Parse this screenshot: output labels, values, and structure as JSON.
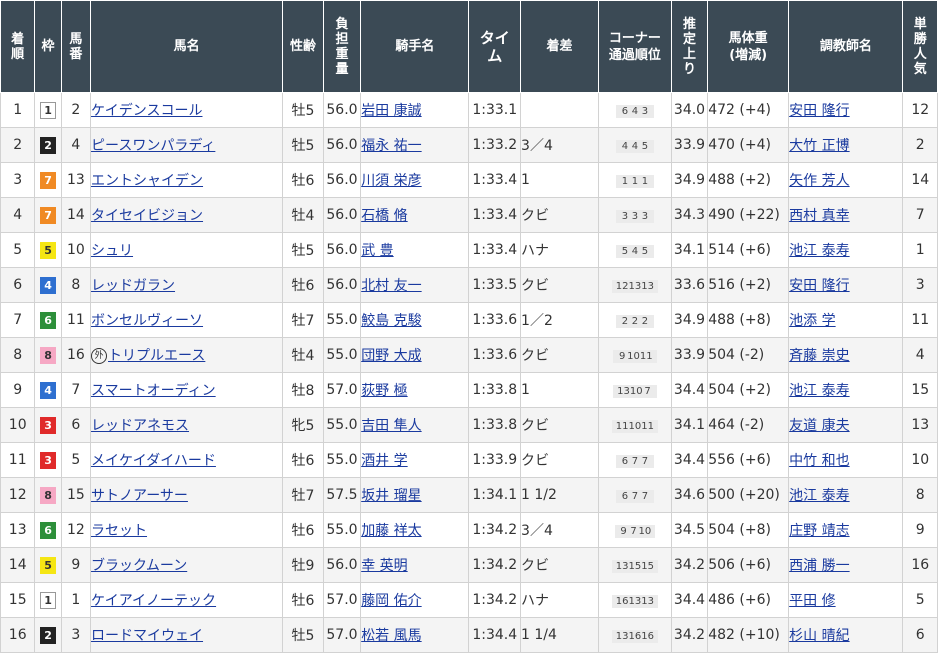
{
  "headers": {
    "rank": "着順",
    "waku": "枠",
    "umaban": "馬番",
    "horse": "馬名",
    "sexage": "性齢",
    "weight": "負担重量",
    "jockey": "騎手名",
    "time": "タイム",
    "margin": "着差",
    "corner": "コーナー通過順位",
    "last3f": "推定上り",
    "body": "馬体重(増減)",
    "trainer": "調教師名",
    "pop": "単勝人気"
  },
  "waku_colors": {
    "1": {
      "bg": "#ffffff",
      "fg": "#333333",
      "border": "#999999"
    },
    "2": {
      "bg": "#222222",
      "fg": "#ffffff",
      "border": "#222222"
    },
    "3": {
      "bg": "#e02a2a",
      "fg": "#ffffff",
      "border": "#e02a2a"
    },
    "4": {
      "bg": "#2e6fd0",
      "fg": "#ffffff",
      "border": "#2e6fd0"
    },
    "5": {
      "bg": "#f5e614",
      "fg": "#333333",
      "border": "#f5e614"
    },
    "6": {
      "bg": "#2d8f3a",
      "fg": "#ffffff",
      "border": "#2d8f3a"
    },
    "7": {
      "bg": "#f08a24",
      "fg": "#ffffff",
      "border": "#f08a24"
    },
    "8": {
      "bg": "#f6a8c4",
      "fg": "#333333",
      "border": "#f6a8c4"
    }
  },
  "rows": [
    {
      "rank": "1",
      "waku": "1",
      "umaban": "2",
      "horse": "ケイデンスコール",
      "foreign": false,
      "sexage": "牡5",
      "weight": "56.0",
      "jockey": "岩田 康誠",
      "time": "1:33.1",
      "margin": "",
      "corner": [
        "6",
        "4",
        "3"
      ],
      "last3f": "34.0",
      "body": "472 (+4)",
      "trainer": "安田 隆行",
      "pop": "12"
    },
    {
      "rank": "2",
      "waku": "2",
      "umaban": "4",
      "horse": "ピースワンパラディ",
      "foreign": false,
      "sexage": "牡5",
      "weight": "56.0",
      "jockey": "福永 祐一",
      "time": "1:33.2",
      "margin": "3／4",
      "corner": [
        "4",
        "4",
        "5"
      ],
      "last3f": "33.9",
      "body": "470 (+4)",
      "trainer": "大竹 正博",
      "pop": "2"
    },
    {
      "rank": "3",
      "waku": "7",
      "umaban": "13",
      "horse": "エントシャイデン",
      "foreign": false,
      "sexage": "牡6",
      "weight": "56.0",
      "jockey": "川須 栄彦",
      "time": "1:33.4",
      "margin": "1",
      "corner": [
        "1",
        "1",
        "1"
      ],
      "last3f": "34.9",
      "body": "488 (+2)",
      "trainer": "矢作 芳人",
      "pop": "14"
    },
    {
      "rank": "4",
      "waku": "7",
      "umaban": "14",
      "horse": "タイセイビジョン",
      "foreign": false,
      "sexage": "牡4",
      "weight": "56.0",
      "jockey": "石橋 脩",
      "time": "1:33.4",
      "margin": "クビ",
      "corner": [
        "3",
        "3",
        "3"
      ],
      "last3f": "34.3",
      "body": "490 (+22)",
      "trainer": "西村 真幸",
      "pop": "7"
    },
    {
      "rank": "5",
      "waku": "5",
      "umaban": "10",
      "horse": "シュリ",
      "foreign": false,
      "sexage": "牡5",
      "weight": "56.0",
      "jockey": "武 豊",
      "time": "1:33.4",
      "margin": "ハナ",
      "corner": [
        "5",
        "4",
        "5"
      ],
      "last3f": "34.1",
      "body": "514 (+6)",
      "trainer": "池江 泰寿",
      "pop": "1"
    },
    {
      "rank": "6",
      "waku": "4",
      "umaban": "8",
      "horse": "レッドガラン",
      "foreign": false,
      "sexage": "牡6",
      "weight": "56.0",
      "jockey": "北村 友一",
      "time": "1:33.5",
      "margin": "クビ",
      "corner": [
        "12",
        "13",
        "13"
      ],
      "last3f": "33.6",
      "body": "516 (+2)",
      "trainer": "安田 隆行",
      "pop": "3"
    },
    {
      "rank": "7",
      "waku": "6",
      "umaban": "11",
      "horse": "ボンセルヴィーソ",
      "foreign": false,
      "sexage": "牡7",
      "weight": "55.0",
      "jockey": "鮫島 克駿",
      "time": "1:33.6",
      "margin": "1／2",
      "corner": [
        "2",
        "2",
        "2"
      ],
      "last3f": "34.9",
      "body": "488 (+8)",
      "trainer": "池添 学",
      "pop": "11"
    },
    {
      "rank": "8",
      "waku": "8",
      "umaban": "16",
      "horse": "トリプルエース",
      "foreign": true,
      "foreign_mark": "外",
      "sexage": "牡4",
      "weight": "55.0",
      "jockey": "団野 大成",
      "time": "1:33.6",
      "margin": "クビ",
      "corner": [
        "9",
        "10",
        "11"
      ],
      "last3f": "33.9",
      "body": "504 (-2)",
      "trainer": "斉藤 崇史",
      "pop": "4"
    },
    {
      "rank": "9",
      "waku": "4",
      "umaban": "7",
      "horse": "スマートオーディン",
      "foreign": false,
      "sexage": "牡8",
      "weight": "57.0",
      "jockey": "荻野 極",
      "time": "1:33.8",
      "margin": "1",
      "corner": [
        "13",
        "10",
        "7"
      ],
      "last3f": "34.4",
      "body": "504 (+2)",
      "trainer": "池江 泰寿",
      "pop": "15"
    },
    {
      "rank": "10",
      "waku": "3",
      "umaban": "6",
      "horse": "レッドアネモス",
      "foreign": false,
      "sexage": "牝5",
      "weight": "55.0",
      "jockey": "吉田 隼人",
      "time": "1:33.8",
      "margin": "クビ",
      "corner": [
        "11",
        "10",
        "11"
      ],
      "last3f": "34.1",
      "body": "464 (-2)",
      "trainer": "友道 康夫",
      "pop": "13"
    },
    {
      "rank": "11",
      "waku": "3",
      "umaban": "5",
      "horse": "メイケイダイハード",
      "foreign": false,
      "sexage": "牡6",
      "weight": "55.0",
      "jockey": "酒井 学",
      "time": "1:33.9",
      "margin": "クビ",
      "corner": [
        "6",
        "7",
        "7"
      ],
      "last3f": "34.4",
      "body": "556 (+6)",
      "trainer": "中竹 和也",
      "pop": "10"
    },
    {
      "rank": "12",
      "waku": "8",
      "umaban": "15",
      "horse": "サトノアーサー",
      "foreign": false,
      "sexage": "牡7",
      "weight": "57.5",
      "jockey": "坂井 瑠星",
      "time": "1:34.1",
      "margin": "1 1/2",
      "corner": [
        "6",
        "7",
        "7"
      ],
      "last3f": "34.6",
      "body": "500 (+20)",
      "trainer": "池江 泰寿",
      "pop": "8"
    },
    {
      "rank": "13",
      "waku": "6",
      "umaban": "12",
      "horse": "ラセット",
      "foreign": false,
      "sexage": "牡6",
      "weight": "55.0",
      "jockey": "加藤 祥太",
      "time": "1:34.2",
      "margin": "3／4",
      "corner": [
        "9",
        "7",
        "10"
      ],
      "last3f": "34.5",
      "body": "504 (+8)",
      "trainer": "庄野 靖志",
      "pop": "9"
    },
    {
      "rank": "14",
      "waku": "5",
      "umaban": "9",
      "horse": "ブラックムーン",
      "foreign": false,
      "sexage": "牡9",
      "weight": "56.0",
      "jockey": "幸 英明",
      "time": "1:34.2",
      "margin": "クビ",
      "corner": [
        "13",
        "15",
        "15"
      ],
      "last3f": "34.2",
      "body": "506 (+6)",
      "trainer": "西浦 勝一",
      "pop": "16"
    },
    {
      "rank": "15",
      "waku": "1",
      "umaban": "1",
      "horse": "ケイアイノーテック",
      "foreign": false,
      "sexage": "牡6",
      "weight": "57.0",
      "jockey": "藤岡 佑介",
      "time": "1:34.2",
      "margin": "ハナ",
      "corner": [
        "16",
        "13",
        "13"
      ],
      "last3f": "34.4",
      "body": "486 (+6)",
      "trainer": "平田 修",
      "pop": "5"
    },
    {
      "rank": "16",
      "waku": "2",
      "umaban": "3",
      "horse": "ロードマイウェイ",
      "foreign": false,
      "sexage": "牡5",
      "weight": "57.0",
      "jockey": "松若 風馬",
      "time": "1:34.4",
      "margin": "1 1/4",
      "corner": [
        "13",
        "16",
        "16"
      ],
      "last3f": "34.2",
      "body": "482 (+10)",
      "trainer": "杉山 晴紀",
      "pop": "6"
    }
  ]
}
